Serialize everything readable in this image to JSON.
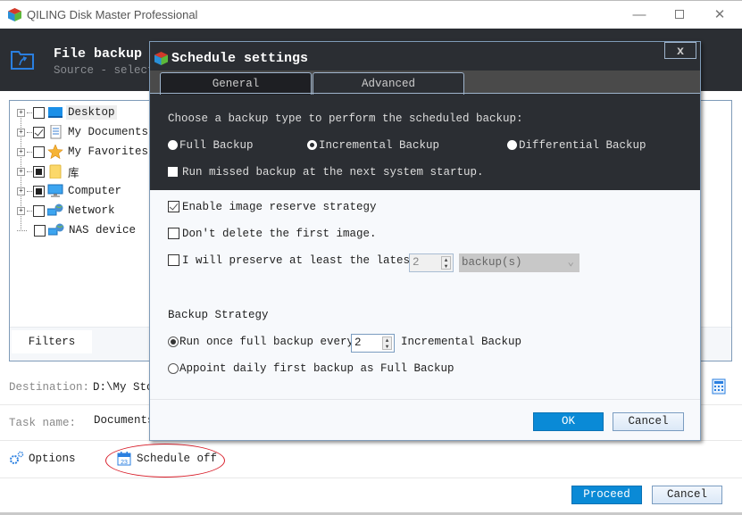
{
  "window": {
    "title": "QILING Disk Master Professional",
    "controls": [
      "minimize",
      "maximize",
      "close"
    ]
  },
  "header": {
    "title": "File backup",
    "subtitle": "Source - select"
  },
  "tree": {
    "items": [
      {
        "label": "Desktop",
        "icon": "desktop-icon",
        "state": "unchecked",
        "expandable": true,
        "highlighted": true
      },
      {
        "label": "My Documents",
        "icon": "documents-icon",
        "state": "checked",
        "expandable": true
      },
      {
        "label": "My Favorites",
        "icon": "star-icon",
        "state": "unchecked",
        "expandable": true
      },
      {
        "label": "库",
        "icon": "folder-icon",
        "state": "partial",
        "expandable": true
      },
      {
        "label": "Computer",
        "icon": "computer-icon",
        "state": "partial",
        "expandable": true
      },
      {
        "label": "Network",
        "icon": "network-icon",
        "state": "unchecked",
        "expandable": true
      },
      {
        "label": "NAS device",
        "icon": "network-icon",
        "state": "unchecked",
        "expandable": false
      }
    ],
    "filters_label": "Filters"
  },
  "form": {
    "destination_label": "Destination:",
    "destination_value": "D:\\My Sto",
    "taskname_label": "Task name:",
    "taskname_value": "Documents"
  },
  "bottom": {
    "options_label": "Options",
    "schedule_label": "Schedule off",
    "proceed_label": "Proceed",
    "cancel_label": "Cancel"
  },
  "dialog": {
    "title": "Schedule settings",
    "close_label": "x",
    "tabs": [
      {
        "label": "General",
        "active": false
      },
      {
        "label": "Advanced",
        "active": true
      }
    ],
    "backup_type_prompt": "Choose a backup type to perform the scheduled backup:",
    "backup_types": [
      {
        "label": "Full Backup",
        "selected": false
      },
      {
        "label": "Incremental Backup",
        "selected": true
      },
      {
        "label": "Differential Backup",
        "selected": false
      }
    ],
    "run_missed_label": "Run missed backup at the next system startup.",
    "run_missed_checked": false,
    "enable_reserve_label": "Enable image reserve strategy",
    "enable_reserve_checked": true,
    "dont_delete_label": "Don't delete the first image.",
    "dont_delete_checked": false,
    "preserve_label": "I will preserve at least the latest",
    "preserve_checked": false,
    "preserve_count": "2",
    "preserve_unit": "backup(s)",
    "strategy_heading": "Backup Strategy",
    "strategy_options": [
      {
        "label_before": "Run once full backup every",
        "value": "2",
        "label_after": "Incremental Backup",
        "selected": true
      },
      {
        "label": "Appoint daily first backup as Full Backup",
        "selected": false
      }
    ],
    "ok_label": "OK",
    "cancel_label": "Cancel"
  },
  "colors": {
    "header_bg": "#2b2e33",
    "primary_button": "#0a8ad6",
    "annotation_ellipse": "#d81e2a"
  }
}
